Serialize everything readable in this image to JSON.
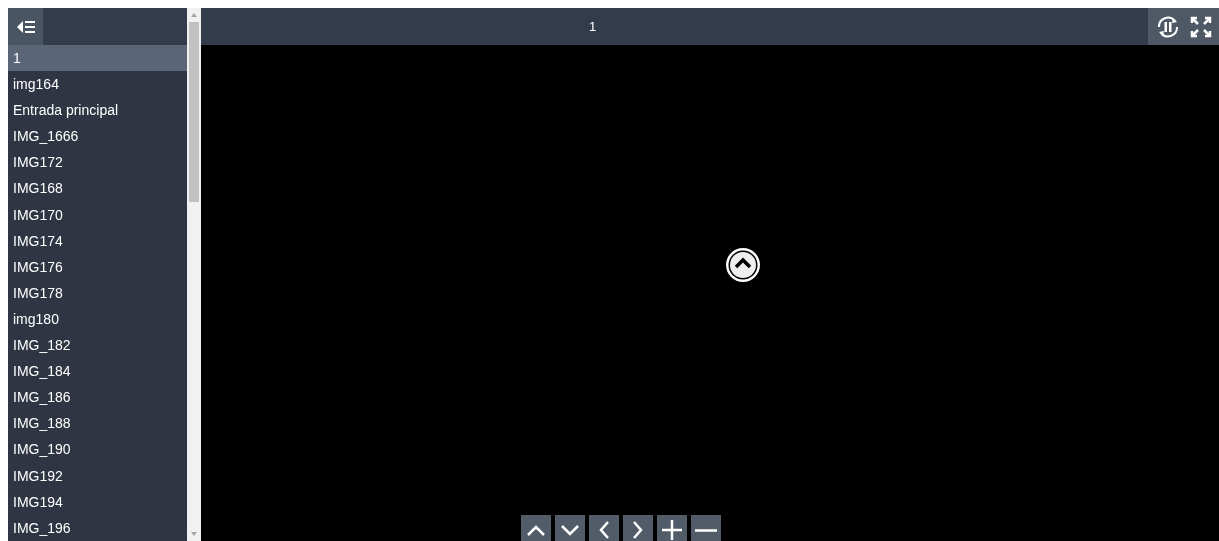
{
  "sidebar": {
    "items": [
      {
        "label": "1",
        "selected": true
      },
      {
        "label": "img164",
        "selected": false
      },
      {
        "label": "Entrada principal",
        "selected": false
      },
      {
        "label": "IMG_1666",
        "selected": false
      },
      {
        "label": "IMG172",
        "selected": false
      },
      {
        "label": "IMG168",
        "selected": false
      },
      {
        "label": "IMG170",
        "selected": false
      },
      {
        "label": "IMG174",
        "selected": false
      },
      {
        "label": "IMG176",
        "selected": false
      },
      {
        "label": "IMG178",
        "selected": false
      },
      {
        "label": "img180",
        "selected": false
      },
      {
        "label": "IMG_182",
        "selected": false
      },
      {
        "label": "IMG_184",
        "selected": false
      },
      {
        "label": "IMG_186",
        "selected": false
      },
      {
        "label": "IMG_188",
        "selected": false
      },
      {
        "label": "IMG_190",
        "selected": false
      },
      {
        "label": "IMG192",
        "selected": false
      },
      {
        "label": "IMG194",
        "selected": false
      },
      {
        "label": "IMG_196",
        "selected": false
      }
    ]
  },
  "viewer": {
    "title": "1",
    "controls": [
      {
        "kind": "up"
      },
      {
        "kind": "down"
      },
      {
        "kind": "left"
      },
      {
        "kind": "right"
      },
      {
        "kind": "zoom-in"
      },
      {
        "kind": "zoom-out"
      }
    ]
  }
}
